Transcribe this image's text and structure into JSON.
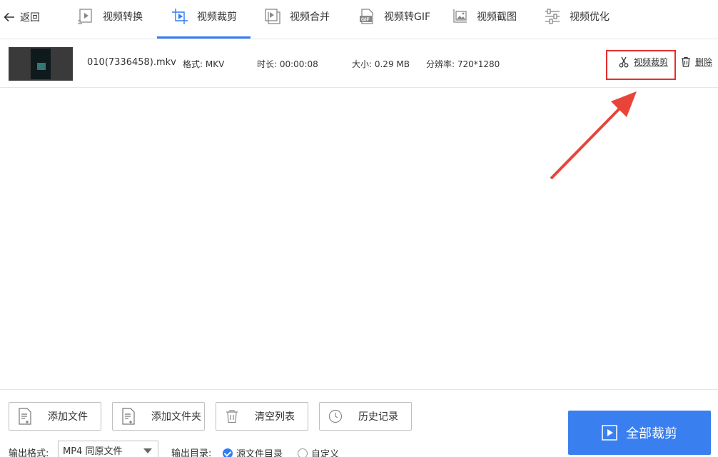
{
  "nav": {
    "back_label": "返回",
    "tabs": [
      {
        "label": "视频转换",
        "icon": "video-convert-icon"
      },
      {
        "label": "视频裁剪",
        "icon": "video-crop-icon",
        "active": true
      },
      {
        "label": "视频合并",
        "icon": "video-merge-icon"
      },
      {
        "label": "视频转GIF",
        "icon": "gif-icon"
      },
      {
        "label": "视频截图",
        "icon": "image-icon"
      },
      {
        "label": "视频优化",
        "icon": "sliders-icon"
      }
    ]
  },
  "file": {
    "name": "010(7336458).mkv",
    "format": "格式: MKV",
    "duration": "时长: 00:00:08",
    "size": "大小: 0.29 MB",
    "resolution": "分辨率: 720*1280",
    "cut_label": "视频裁剪",
    "delete_label": "删除"
  },
  "bottom": {
    "add_file": "添加文件",
    "add_folder": "添加文件夹",
    "clear_list": "清空列表",
    "history": "历史记录",
    "output_format_label": "输出格式:",
    "output_format_value": "MP4 同原文件",
    "output_dir_label": "输出目录:",
    "dir_source": "源文件目录",
    "dir_custom": "自定义",
    "crop_all": "全部裁剪"
  },
  "colors": {
    "accent": "#2e7cf6",
    "primary_button": "#3a7ff0",
    "annotation_red": "#e62e2e"
  }
}
